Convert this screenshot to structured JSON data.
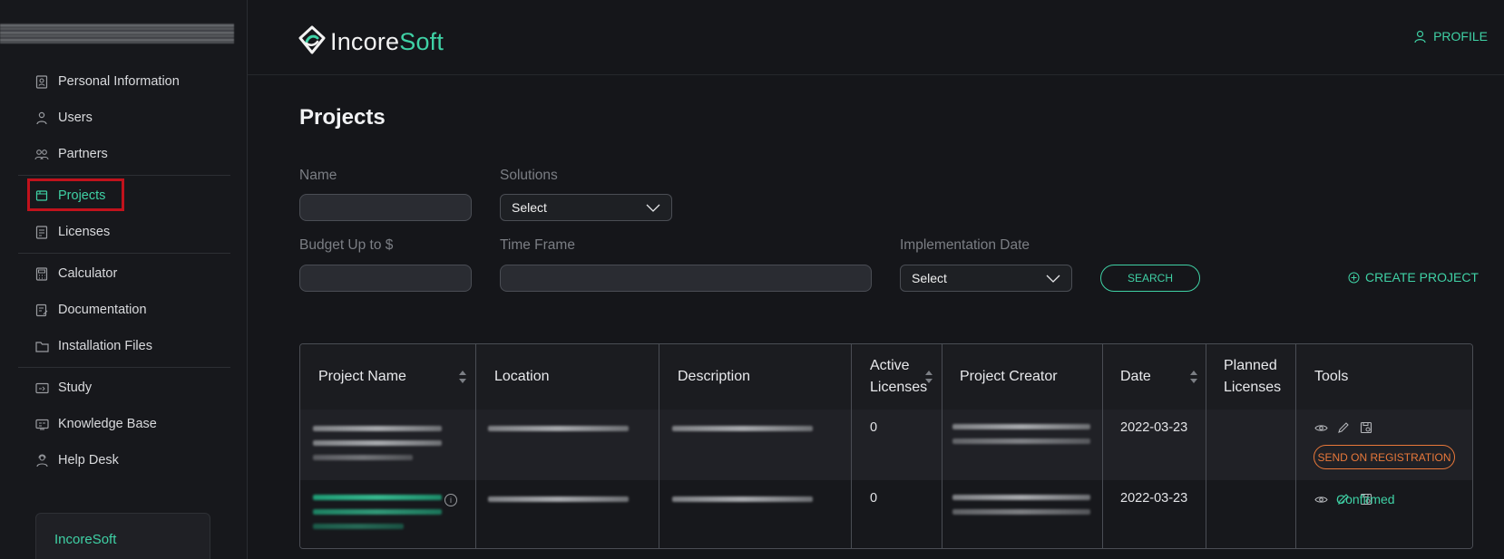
{
  "brand": {
    "logo_part1": "Incore",
    "logo_part2": "Soft"
  },
  "header": {
    "profile_label": "PROFILE"
  },
  "sidebar": {
    "items": [
      {
        "label": "Personal Information",
        "icon": "id-card-icon"
      },
      {
        "label": "Users",
        "icon": "user-icon"
      },
      {
        "label": "Partners",
        "icon": "partners-icon"
      },
      {
        "label": "Projects",
        "icon": "folder-icon",
        "active": true
      },
      {
        "label": "Licenses",
        "icon": "license-icon"
      },
      {
        "label": "Calculator",
        "icon": "calculator-icon"
      },
      {
        "label": "Documentation",
        "icon": "document-edit-icon"
      },
      {
        "label": "Installation Files",
        "icon": "folder-outline-icon"
      },
      {
        "label": "Study",
        "icon": "study-icon"
      },
      {
        "label": "Knowledge Base",
        "icon": "knowledge-icon"
      },
      {
        "label": "Help Desk",
        "icon": "help-desk-icon"
      }
    ],
    "card_label": "IncoreSoft"
  },
  "page": {
    "title": "Projects"
  },
  "filters": {
    "name_label": "Name",
    "solutions_label": "Solutions",
    "solutions_value": "Select",
    "budget_label": "Budget Up to $",
    "timeframe_label": "Time Frame",
    "impl_date_label": "Implementation Date",
    "impl_date_value": "Select",
    "search_button": "SEARCH",
    "create_button": "CREATE PROJECT"
  },
  "table": {
    "headers": [
      "Project Name",
      "Location",
      "Description",
      "Active Licenses",
      "Project Creator",
      "Date",
      "Planned Licenses",
      "Tools"
    ],
    "rows": [
      {
        "active_licenses": "0",
        "date": "2022-03-23",
        "action": "SEND ON REGISTRATION"
      },
      {
        "active_licenses": "0",
        "date": "2022-03-23",
        "status": "Confirmed"
      }
    ]
  },
  "colors": {
    "accent": "#3fd1a5",
    "warning": "#e8783a",
    "highlight": "#c1121c",
    "background": "#15161a"
  }
}
